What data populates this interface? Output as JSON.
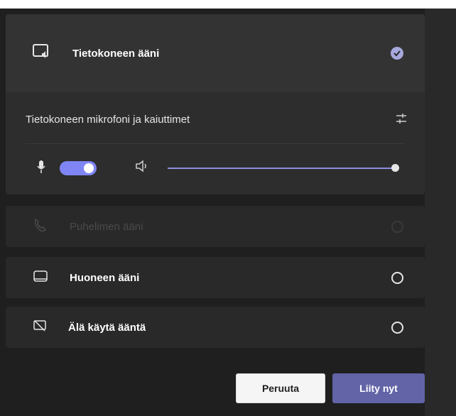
{
  "audio_options": {
    "computer_audio": {
      "label": "Tietokoneen ääni",
      "icon": "computer-audio-icon",
      "status": "selected"
    },
    "phone_audio": {
      "label": "Puhelimen ääni",
      "icon": "phone-icon",
      "status": "disabled"
    },
    "room_audio": {
      "label": "Huoneen ääni",
      "icon": "room-icon",
      "status": "unselected"
    },
    "no_audio": {
      "label": "Älä käytä ääntä",
      "icon": "no-audio-icon",
      "status": "unselected"
    }
  },
  "device_panel": {
    "title": "Tietokoneen mikrofoni ja kaiuttimet",
    "mic_enabled": true,
    "speaker_volume": 1.0
  },
  "buttons": {
    "cancel_label": "Peruuta",
    "join_label": "Liity nyt"
  },
  "colors": {
    "accent": "#6264a7",
    "toggle": "#7f85f5",
    "check": "#a6a7dc",
    "background": "#1f1f1f"
  }
}
